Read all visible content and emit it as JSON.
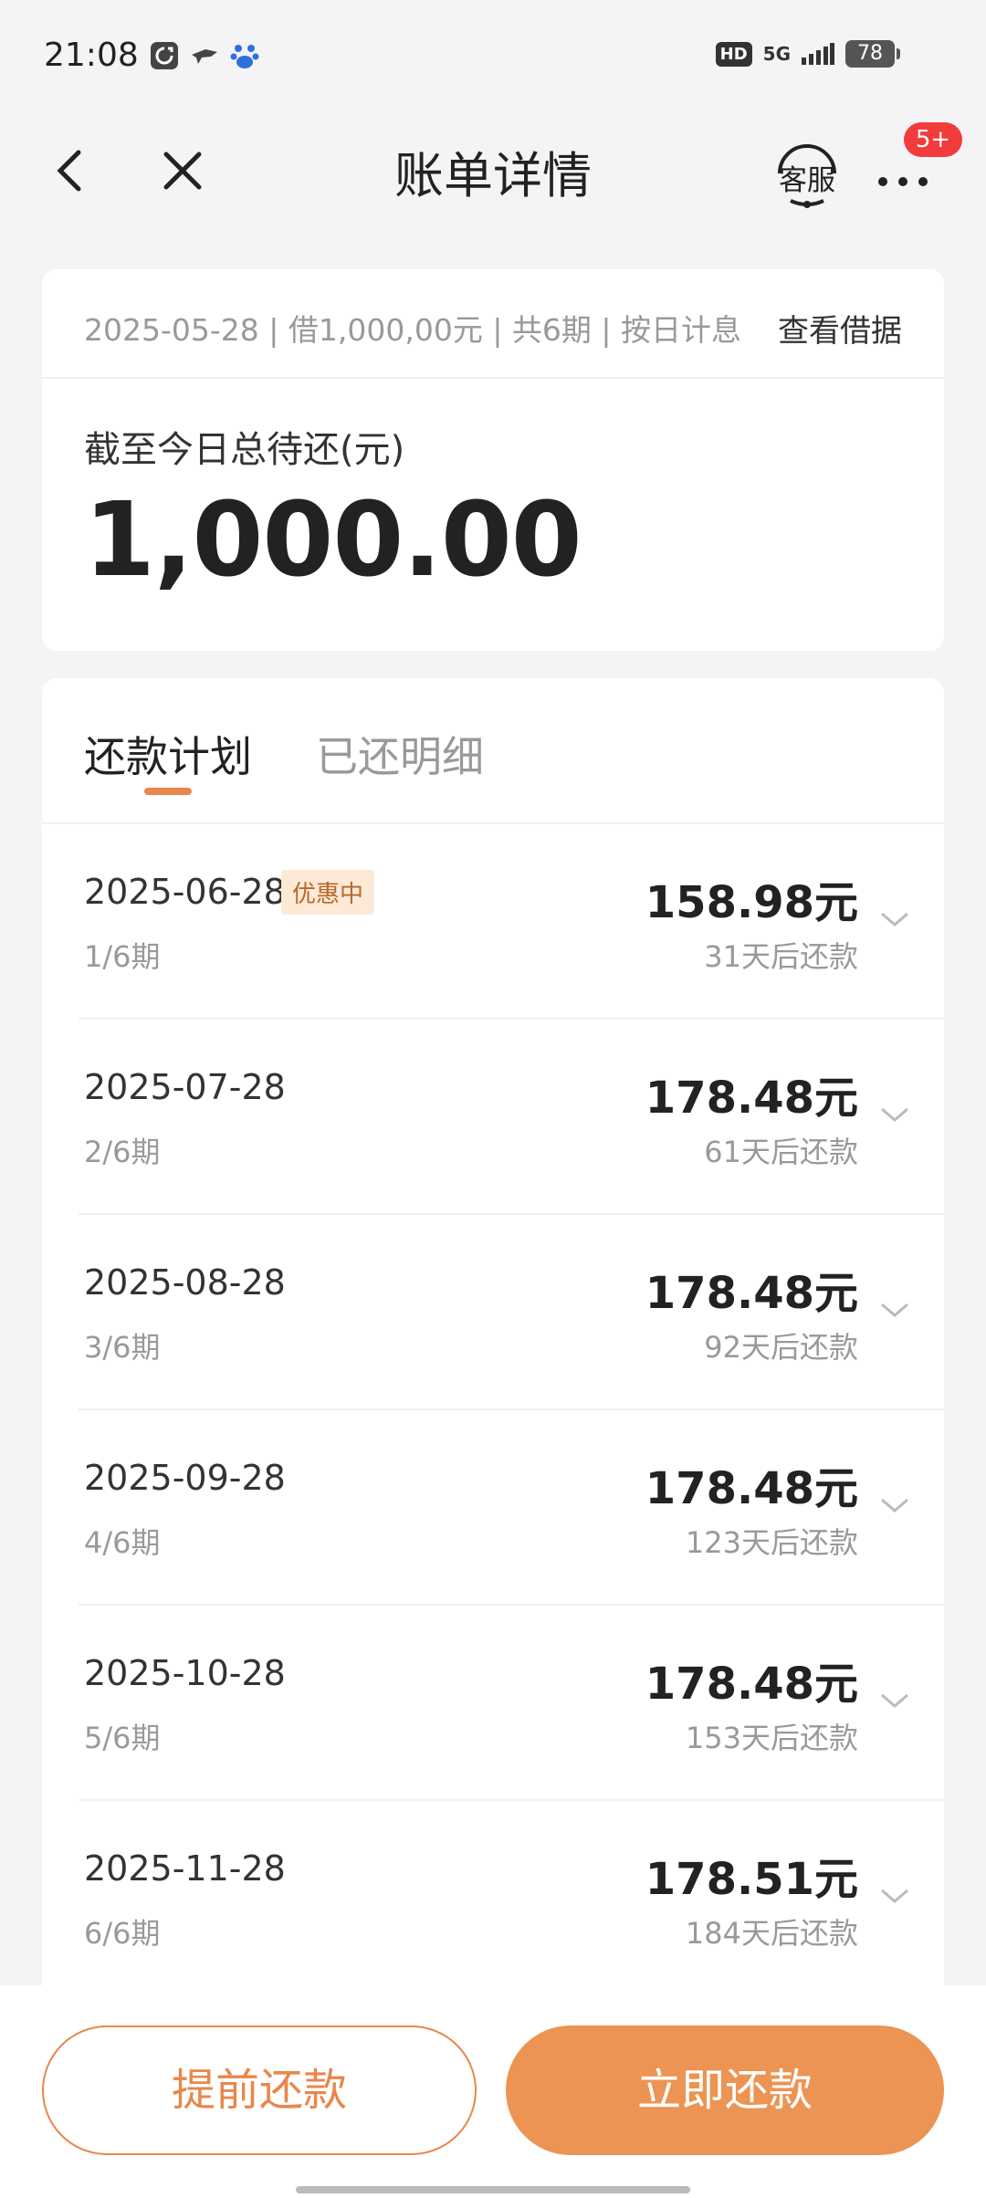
{
  "status_bar": {
    "time": "21:08",
    "hd": "HD",
    "signal": "5G",
    "battery": "78"
  },
  "nav": {
    "title": "账单详情",
    "service_label": "客服",
    "more_badge": "5+"
  },
  "summary": {
    "loan_info": "2025-05-28 | 借1,000,00元 | 共6期 | 按日计息",
    "view_note": "查看借据",
    "total_label": "截至今日总待还(元)",
    "total_amount": "1,000.00"
  },
  "tabs": [
    {
      "label": "还款计划",
      "active": true
    },
    {
      "label": "已还明细",
      "active": false
    }
  ],
  "plan": [
    {
      "date": "2025-06-28",
      "term": "1/6期",
      "amount": "158.98元",
      "due": "31天后还款",
      "tag": "优惠中"
    },
    {
      "date": "2025-07-28",
      "term": "2/6期",
      "amount": "178.48元",
      "due": "61天后还款"
    },
    {
      "date": "2025-08-28",
      "term": "3/6期",
      "amount": "178.48元",
      "due": "92天后还款"
    },
    {
      "date": "2025-09-28",
      "term": "4/6期",
      "amount": "178.48元",
      "due": "123天后还款"
    },
    {
      "date": "2025-10-28",
      "term": "5/6期",
      "amount": "178.48元",
      "due": "153天后还款"
    },
    {
      "date": "2025-11-28",
      "term": "6/6期",
      "amount": "178.51元",
      "due": "184天后还款"
    }
  ],
  "actions": {
    "prepay": "提前还款",
    "repay_now": "立即还款"
  },
  "colors": {
    "accent": "#e8874b",
    "badge": "#f23c3c",
    "promo_bg": "#fde9d6"
  }
}
